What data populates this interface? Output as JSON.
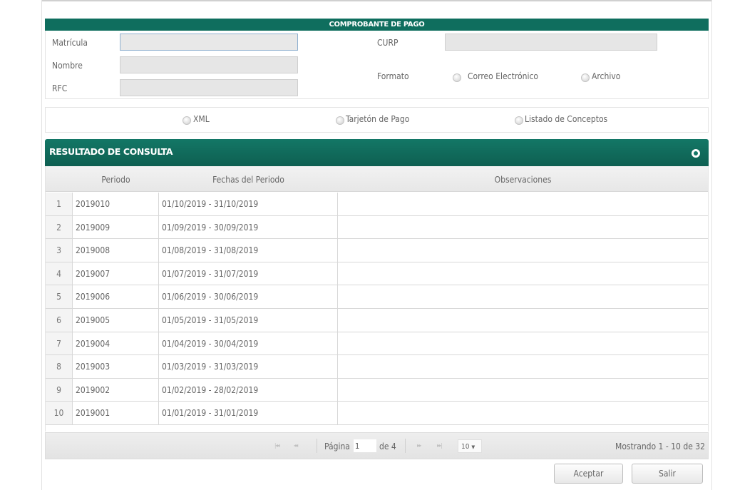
{
  "comprobante": {
    "title": "COMPROBANTE DE PAGO",
    "labels": {
      "matricula": "Matrícula",
      "nombre": "Nombre",
      "rfc": "RFC",
      "curp": "CURP",
      "formato": "Formato"
    },
    "formato_options": [
      "Correo Electrónico",
      "Archivo"
    ],
    "tipo_options": [
      "XML",
      "Tarjetón de Pago",
      "Listado de Conceptos"
    ]
  },
  "resultado": {
    "title": "RESULTADO DE CONSULTA",
    "columns": [
      "Periodo",
      "Fechas del Periodo",
      "Observaciones"
    ],
    "rows": [
      {
        "num": "1",
        "periodo": "2019010",
        "fechas": "01/10/2019 - 31/10/2019",
        "obs": ""
      },
      {
        "num": "2",
        "periodo": "2019009",
        "fechas": "01/09/2019 - 30/09/2019",
        "obs": ""
      },
      {
        "num": "3",
        "periodo": "2019008",
        "fechas": "01/08/2019 - 31/08/2019",
        "obs": ""
      },
      {
        "num": "4",
        "periodo": "2019007",
        "fechas": "01/07/2019 - 31/07/2019",
        "obs": ""
      },
      {
        "num": "5",
        "periodo": "2019006",
        "fechas": "01/06/2019 - 30/06/2019",
        "obs": ""
      },
      {
        "num": "6",
        "periodo": "2019005",
        "fechas": "01/05/2019 - 31/05/2019",
        "obs": ""
      },
      {
        "num": "7",
        "periodo": "2019004",
        "fechas": "01/04/2019 - 30/04/2019",
        "obs": ""
      },
      {
        "num": "8",
        "periodo": "2019003",
        "fechas": "01/03/2019 - 31/03/2019",
        "obs": ""
      },
      {
        "num": "9",
        "periodo": "2019002",
        "fechas": "01/02/2019 - 28/02/2019",
        "obs": ""
      },
      {
        "num": "10",
        "periodo": "2019001",
        "fechas": "01/01/2019 - 31/01/2019",
        "obs": ""
      }
    ]
  },
  "pager": {
    "pagina_label": "Página",
    "page_value": "1",
    "de_label": "de 4",
    "page_size": "10",
    "showing": "Mostrando 1 - 10 de 32",
    "icons": {
      "first": "|◂◂",
      "prev": "◂◂",
      "next": "▸▸",
      "last": "▸▸|"
    }
  },
  "actions": {
    "aceptar": "Aceptar",
    "salir": "Salir"
  },
  "colors": {
    "header_green": "#0f6e5e",
    "text_gray": "#666666"
  }
}
